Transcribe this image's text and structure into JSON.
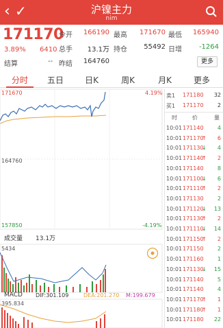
{
  "header": {
    "title": "沪镍主力",
    "subtitle": "nim",
    "back_glyph": "‹",
    "check_glyph": "✓",
    "bg_color": "#e2433a"
  },
  "quote": {
    "last_price": "171170",
    "pct_change": "3.89%",
    "change": "6410",
    "settle_label": "结算",
    "settle_value": "--",
    "fields": [
      {
        "label": "今开",
        "value": "166190",
        "tone": "red"
      },
      {
        "label": "最高",
        "value": "171670",
        "tone": "red"
      },
      {
        "label": "最低",
        "value": "165940",
        "tone": "red"
      },
      {
        "label": "总手",
        "value": "13.1万",
        "tone": "dark"
      },
      {
        "label": "持仓",
        "value": "55492",
        "tone": "dark"
      },
      {
        "label": "日增",
        "value": "-1264",
        "tone": "green"
      },
      {
        "label": "昨结",
        "value": "164760",
        "tone": "dark"
      }
    ],
    "more_label": "更多"
  },
  "tabs": [
    {
      "label": "分时",
      "active": true
    },
    {
      "label": "五日",
      "active": false
    },
    {
      "label": "日K",
      "active": false
    },
    {
      "label": "周K",
      "active": false
    },
    {
      "label": "月K",
      "active": false
    },
    {
      "label": "更多",
      "active": false
    }
  ],
  "chart": {
    "top_price": "171670",
    "mid_price": "164760",
    "low_price": "157850",
    "top_pct": "4.19%",
    "low_pct": "-4.19%",
    "volume_label": "成交量",
    "volume_value": "13.1万",
    "vol_axis_max": "5434",
    "macd_label": "MACD",
    "dif": "DIF:301.109",
    "dea": "DEA:201.270",
    "macd_value": "M:199.679",
    "macd_axis": "395.834"
  },
  "book": {
    "sell": {
      "label": "卖1",
      "price": "171180",
      "volume": "32"
    },
    "buy": {
      "label": "买1",
      "price": "171170",
      "volume": "2"
    },
    "headers": {
      "time": "时",
      "price": "价",
      "volume": "量"
    },
    "ticks": [
      {
        "time": "10:01",
        "price": "171140",
        "volume": "4",
        "arrow": ""
      },
      {
        "time": "10:01",
        "price": "171170",
        "volume": "6",
        "arrow": "↑"
      },
      {
        "time": "10:01",
        "price": "171130",
        "volume": "4",
        "arrow": "↓"
      },
      {
        "time": "10:01",
        "price": "171140",
        "volume": "2",
        "arrow": "↑"
      },
      {
        "time": "10:01",
        "price": "171140",
        "volume": "8",
        "arrow": ""
      },
      {
        "time": "10:01",
        "price": "171100",
        "volume": "6",
        "arrow": "↓"
      },
      {
        "time": "10:01",
        "price": "171110",
        "volume": "2",
        "arrow": "↑"
      },
      {
        "time": "10:01",
        "price": "171130",
        "volume": "2",
        "arrow": ""
      },
      {
        "time": "10:01",
        "price": "171120",
        "volume": "13",
        "arrow": "↓"
      },
      {
        "time": "10:01",
        "price": "171130",
        "volume": "2",
        "arrow": "↑"
      },
      {
        "time": "10:01",
        "price": "171110",
        "volume": "14",
        "arrow": "↓"
      },
      {
        "time": "10:01",
        "price": "171150",
        "volume": "2",
        "arrow": "↑"
      },
      {
        "time": "10:01",
        "price": "171150",
        "volume": "2",
        "arrow": ""
      },
      {
        "time": "10:01",
        "price": "171160",
        "volume": "1",
        "arrow": ""
      },
      {
        "time": "10:01",
        "price": "171130",
        "volume": "15",
        "arrow": "↓"
      },
      {
        "time": "10:01",
        "price": "171140",
        "volume": "5",
        "arrow": ""
      },
      {
        "time": "10:01",
        "price": "171140",
        "volume": "4",
        "arrow": ""
      },
      {
        "time": "10:01",
        "price": "171170",
        "volume": "1",
        "arrow": "↑"
      },
      {
        "time": "10:01",
        "price": "171180",
        "volume": "1",
        "arrow": "↑"
      },
      {
        "time": "10:01",
        "price": "171180",
        "volume": "22",
        "arrow": ""
      }
    ]
  },
  "colors": {
    "up": "#e2433a",
    "down": "#2c9a3c",
    "price_line": "#3a6fb5",
    "avg_line": "#e6a23c"
  }
}
